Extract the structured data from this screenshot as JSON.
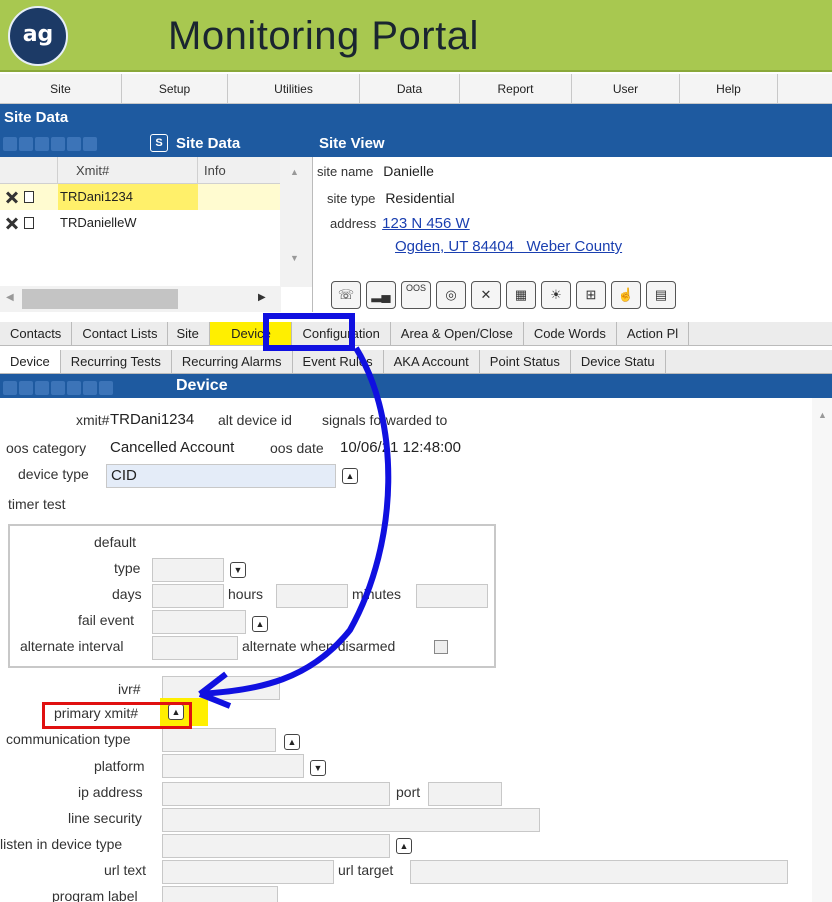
{
  "app": {
    "logo": "ag",
    "title": "Monitoring Portal"
  },
  "menu": [
    "Site",
    "Setup",
    "Utilities",
    "Data",
    "Report",
    "User",
    "Help"
  ],
  "site_data_bar": "Site Data",
  "panels": {
    "left_title": "Site Data",
    "right_title": "Site View"
  },
  "grid": {
    "columns": [
      "Xmit#",
      "Info"
    ],
    "rows": [
      {
        "xmit": "TRDani1234",
        "selected": true
      },
      {
        "xmit": "TRDanielleW",
        "selected": false
      }
    ]
  },
  "site_view": {
    "site_name_label": "site name",
    "site_name": "Danielle",
    "site_type_label": "site type",
    "site_type": "Residential",
    "address_label": "address",
    "address_line1": "123 N 456 W",
    "address_line2": "Ogden, UT 84404   Weber County",
    "oos_icon": "OOS"
  },
  "tabs_primary": [
    "Contacts",
    "Contact Lists",
    "Site",
    "Device",
    "Configuration",
    "Area & Open/Close",
    "Code Words",
    "Action Pl"
  ],
  "tabs_secondary": [
    "Device",
    "Recurring Tests",
    "Recurring Alarms",
    "Event Rules",
    "AKA Account",
    "Point Status",
    "Device Statu"
  ],
  "device_bar": "Device",
  "form": {
    "xmit_label": "xmit#",
    "xmit_value": "TRDani1234",
    "alt_device_label": "alt device id",
    "signals_label": "signals forwarded to",
    "oos_category_label": "oos category",
    "oos_category_value": "Cancelled Account",
    "oos_date_label": "oos date",
    "oos_date_value": "10/06/21 12:48:00",
    "device_type_label": "device type",
    "device_type_value": "CID",
    "timer_test_label": "timer test",
    "default_label": "default",
    "type_label": "type",
    "days_label": "days",
    "hours_label": "hours",
    "minutes_label": "minutes",
    "fail_event_label": "fail event",
    "alternate_interval_label": "alternate interval",
    "alternate_disarmed_label": "alternate when disarmed",
    "ivr_label": "ivr#",
    "primary_xmit_label": "primary xmit#",
    "communication_type_label": "communication type",
    "platform_label": "platform",
    "ip_address_label": "ip address",
    "port_label": "port",
    "line_security_label": "line security",
    "listen_in_label": "listen in device type",
    "url_text_label": "url text",
    "url_target_label": "url target",
    "program_label_label": "program label"
  },
  "colors": {
    "header": "#a8c850",
    "bar": "#1e5aa0",
    "highlight": "#ffef00",
    "arrow": "#1010e0",
    "box": "#e01010"
  }
}
